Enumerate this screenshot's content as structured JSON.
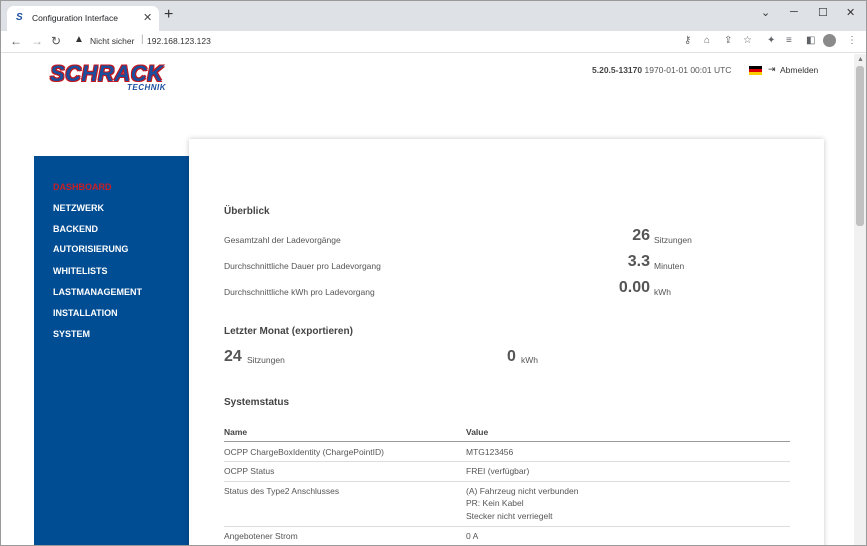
{
  "browser": {
    "tab_title": "Configuration Interface",
    "favicon": "schrack-icon",
    "not_secure": "Nicht sicher",
    "url": "192.168.123.123"
  },
  "header": {
    "logo_main": "SCHRACK",
    "logo_sub": "TECHNIK",
    "version": "5.20.5-13170",
    "datetime": "1970-01-01 00:01 UTC",
    "language_flag": "de",
    "logout_label": "Abmelden"
  },
  "sidebar": {
    "items": [
      {
        "label": "DASHBOARD",
        "active": true
      },
      {
        "label": "NETZWERK",
        "active": false
      },
      {
        "label": "BACKEND",
        "active": false
      },
      {
        "label": "AUTORISIERUNG",
        "active": false
      },
      {
        "label": "WHITELISTS",
        "active": false
      },
      {
        "label": "LASTMANAGEMENT",
        "active": false
      },
      {
        "label": "INSTALLATION",
        "active": false
      },
      {
        "label": "SYSTEM",
        "active": false
      }
    ]
  },
  "overview": {
    "title": "Überblick",
    "rows": [
      {
        "label": "Gesamtzahl der Ladevorgänge",
        "value": "26",
        "unit": "Sitzungen"
      },
      {
        "label": "Durchschnittliche Dauer pro Ladevorgang",
        "value": "3.3",
        "unit": "Minuten"
      },
      {
        "label": "Durchschnittliche kWh pro Ladevorgang",
        "value": "0.00",
        "unit": "kWh"
      }
    ]
  },
  "last_month": {
    "title": "Letzter Monat (exportieren)",
    "sessions_value": "24",
    "sessions_unit": "Sitzungen",
    "kwh_value": "0",
    "kwh_unit": "kWh"
  },
  "system_status": {
    "title": "Systemstatus",
    "columns": [
      "Name",
      "Value"
    ],
    "rows": [
      {
        "name": "OCPP ChargeBoxIdentity (ChargePointID)",
        "value": [
          "MTG123456"
        ]
      },
      {
        "name": "OCPP Status",
        "value": [
          "FREI (verfügbar)"
        ]
      },
      {
        "name": "Status des Type2 Anschlusses",
        "value": [
          "(A) Fahrzeug nicht verbunden",
          "PR: Kein Kabel",
          "Stecker nicht verriegelt"
        ]
      },
      {
        "name": "Angebotener Strom",
        "value": [
          "0 A"
        ]
      }
    ]
  },
  "colors": {
    "sidebar_bg": "#004d93",
    "active_nav": "#c81f26",
    "logo_blue": "#1b4f9e",
    "logo_red": "#c4161c"
  }
}
